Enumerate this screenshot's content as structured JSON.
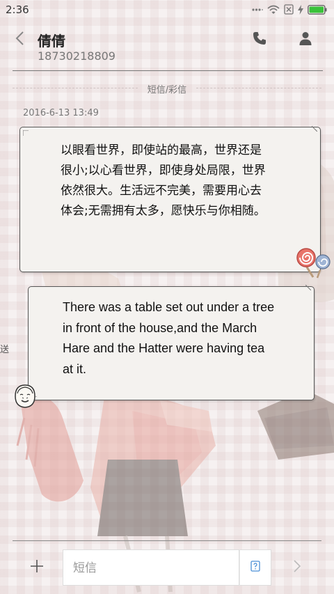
{
  "status_bar": {
    "time": "2:36",
    "icons": [
      "signal-dots-icon",
      "wifi-icon",
      "sim-off-icon",
      "charging-icon",
      "battery-icon"
    ]
  },
  "header": {
    "contact_name": "倩倩",
    "contact_number": "18730218809"
  },
  "thread": {
    "channel_label": "短信/彩信",
    "timestamp": "2016-6-13 13:49",
    "messages": [
      {
        "direction": "sent",
        "text": "以眼看世界，即使站的最高，世界还是很小;以心看世界，即使身处局限，世界依然很大。生活远不完美，需要用心去体会;无需拥有太多，愿快乐与你相随。"
      },
      {
        "direction": "received",
        "text": "There was a table set out under a tree in front of the house,and the March Hare and the Hatter were having tea at it."
      }
    ],
    "side_label": "送"
  },
  "composer": {
    "placeholder": "短信"
  },
  "colors": {
    "accent_battery": "#3ac23a",
    "bubble_bg": "#f4f2ef",
    "bubble_border": "#555555"
  }
}
